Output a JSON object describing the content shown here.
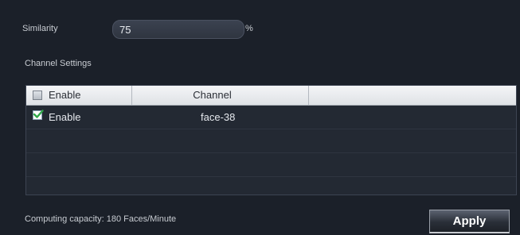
{
  "similarity": {
    "label": "Similarity",
    "value": "75",
    "unit": "%"
  },
  "channel_settings": {
    "title": "Channel Settings",
    "columns": {
      "enable": "Enable",
      "channel": "Channel"
    },
    "header_checkbox_checked": false,
    "rows": [
      {
        "enabled": true,
        "enable_label": "Enable",
        "channel": "face-38"
      }
    ]
  },
  "footer": {
    "capacity_text": "Computing capacity: 180 Faces/Minute",
    "apply_label": "Apply"
  },
  "colors": {
    "background": "#1b2029",
    "check": "#2fa84a"
  }
}
